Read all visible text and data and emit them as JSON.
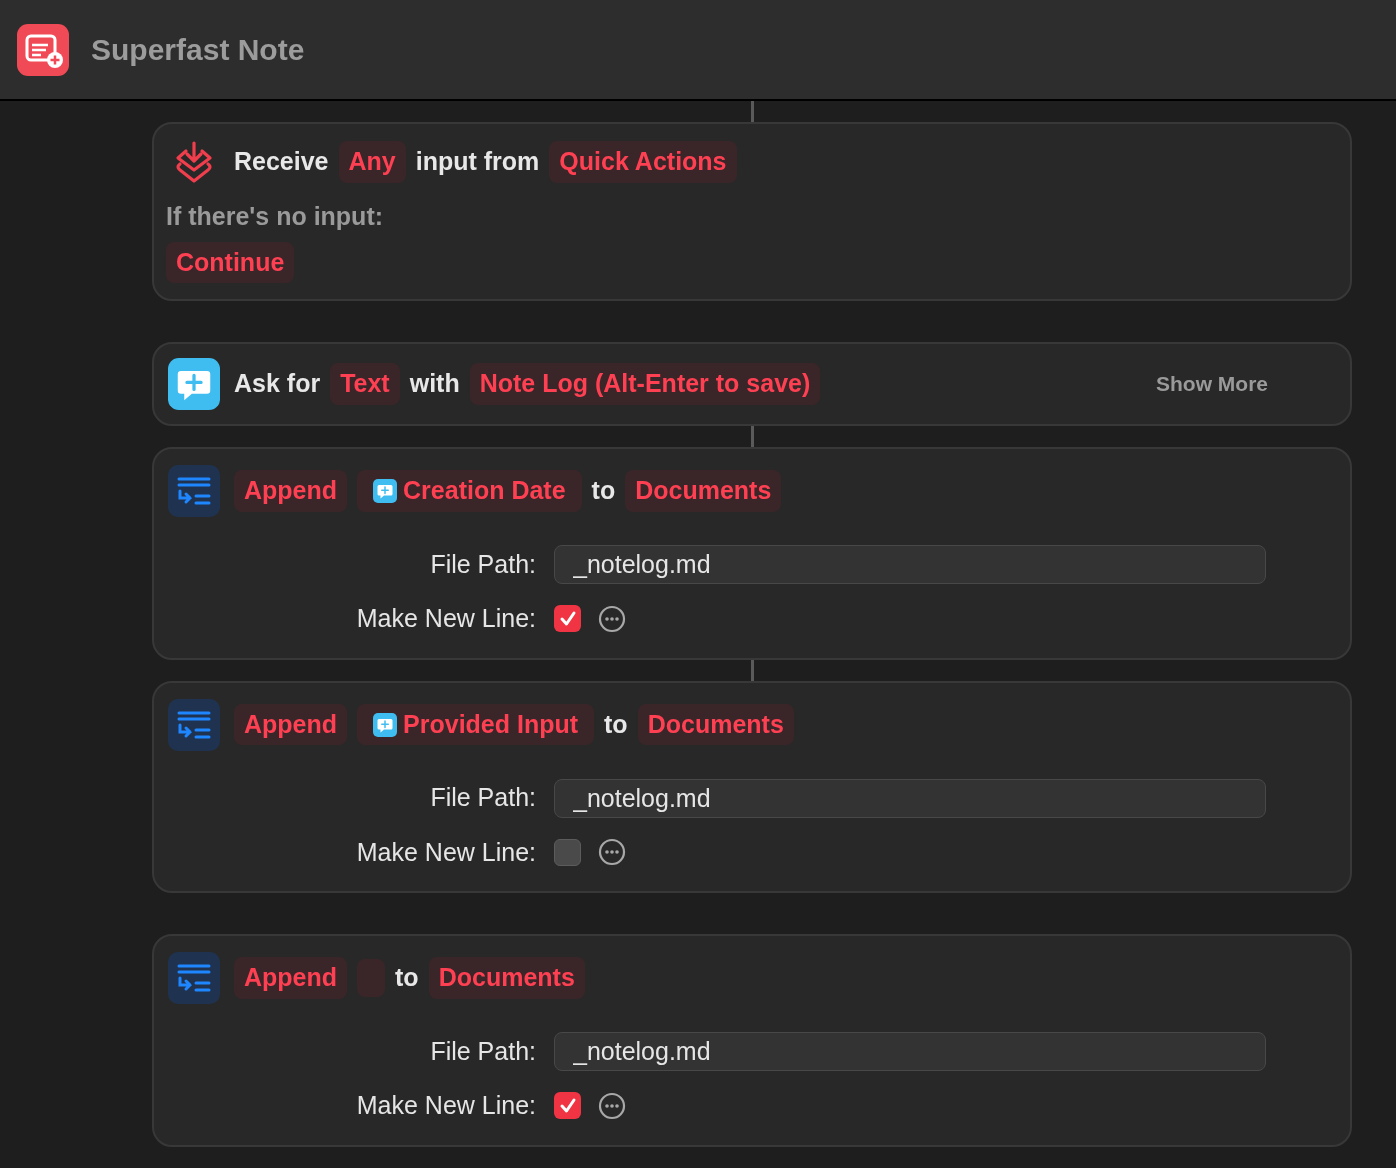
{
  "header": {
    "title": "Superfast Note"
  },
  "actions": [
    {
      "kind": "receive",
      "linked_above": true,
      "parts": [
        {
          "kind": "word",
          "text": "Receive"
        },
        {
          "kind": "token",
          "text": "Any"
        },
        {
          "kind": "word",
          "text": "input from"
        },
        {
          "kind": "token",
          "text": "Quick Actions"
        }
      ],
      "no_input_label": "If there's no input:",
      "no_input_token": "Continue"
    },
    {
      "kind": "ask",
      "linked_above": false,
      "parts": [
        {
          "kind": "word",
          "text": "Ask for"
        },
        {
          "kind": "token",
          "text": "Text"
        },
        {
          "kind": "word",
          "text": "with"
        },
        {
          "kind": "token",
          "text": "Note Log (Alt-Enter to save)"
        }
      ],
      "show_more": "Show More"
    },
    {
      "kind": "append",
      "linked_above": true,
      "parts": [
        {
          "kind": "token",
          "text": "Append"
        },
        {
          "kind": "variable",
          "text": "Creation Date"
        },
        {
          "kind": "word",
          "text": "to"
        },
        {
          "kind": "token",
          "text": "Documents"
        }
      ],
      "file_path_label": "File Path:",
      "file_path": "_notelog.md",
      "new_line_label": "Make New Line:",
      "new_line": true
    },
    {
      "kind": "append",
      "linked_above": true,
      "parts": [
        {
          "kind": "token",
          "text": "Append"
        },
        {
          "kind": "variable",
          "text": "Provided Input"
        },
        {
          "kind": "word",
          "text": "to"
        },
        {
          "kind": "token",
          "text": "Documents"
        }
      ],
      "file_path_label": "File Path:",
      "file_path": "_notelog.md",
      "new_line_label": "Make New Line:",
      "new_line": false
    },
    {
      "kind": "append",
      "linked_above": false,
      "parts": [
        {
          "kind": "token",
          "text": "Append"
        },
        {
          "kind": "blank"
        },
        {
          "kind": "word",
          "text": "to"
        },
        {
          "kind": "token",
          "text": "Documents"
        }
      ],
      "file_path_label": "File Path:",
      "file_path": "_notelog.md",
      "new_line_label": "Make New Line:",
      "new_line": true
    }
  ]
}
